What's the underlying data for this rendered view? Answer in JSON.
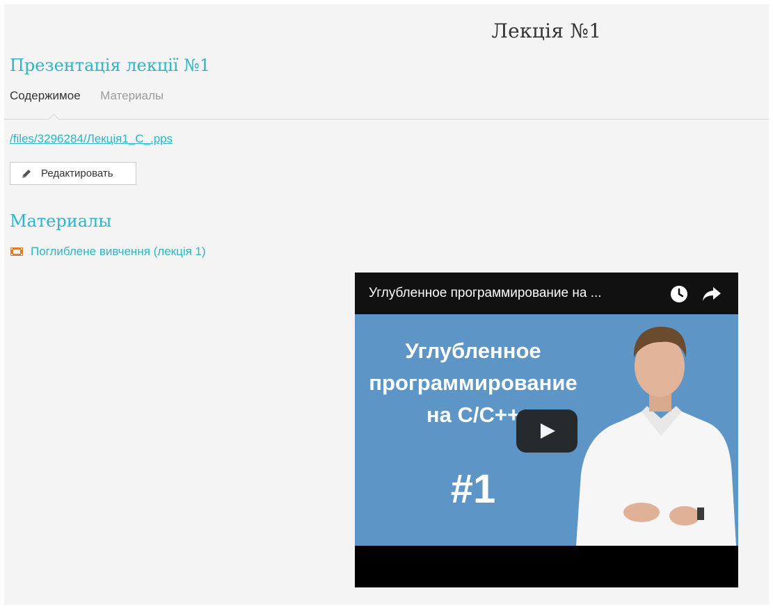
{
  "page": {
    "title": "Лекція №1"
  },
  "section": {
    "title": "Презентація лекції №1"
  },
  "tabs": [
    {
      "label": "Содержимое",
      "active": true
    },
    {
      "label": "Материалы",
      "active": false
    }
  ],
  "content": {
    "file_link": "/files/3296284/Лекція1_C_.pps",
    "edit_button": "Редактировать",
    "edit_icon": "pencil-icon"
  },
  "materials": {
    "title": "Материалы",
    "items": [
      {
        "label": "Поглиблене вивчення (лекція 1)",
        "icon": "film-icon"
      }
    ]
  },
  "video": {
    "title": "Углубленное программирование на ...",
    "thumbnail_lines": [
      "Углубленное",
      "программирование",
      "на С/С++"
    ],
    "thumbnail_number": "#1",
    "icons": [
      "watch-later-icon",
      "share-icon",
      "play-icon"
    ]
  },
  "colors": {
    "accent": "#2fb4c4",
    "background": "#f4f4f4",
    "thumbnail_bg": "#5d95c6",
    "film_icon": "#e07b22"
  }
}
